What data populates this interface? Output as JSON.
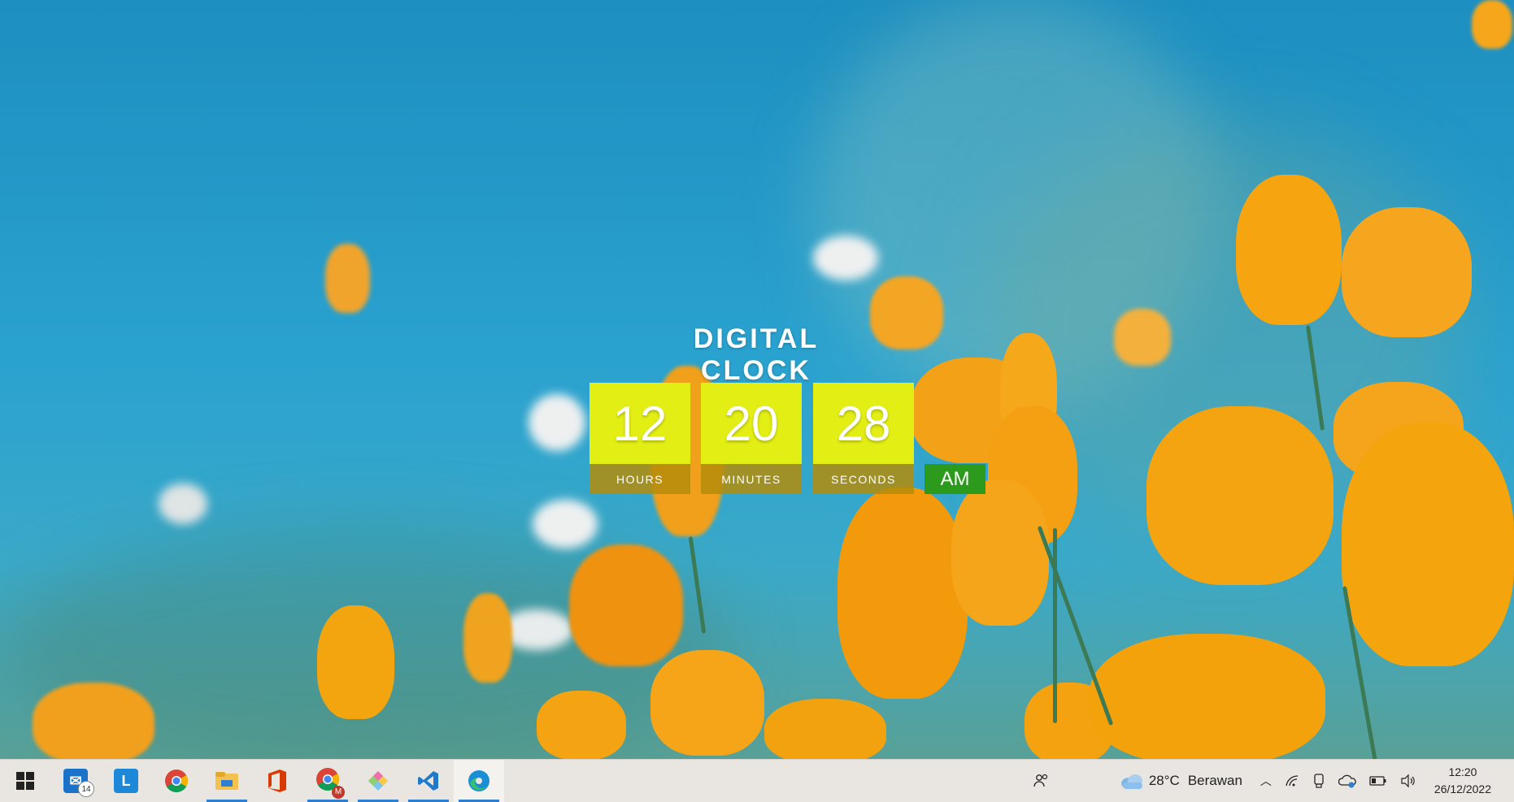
{
  "clock": {
    "title": "DIGITAL CLOCK",
    "hours": "12",
    "hours_label": "HOURS",
    "minutes": "20",
    "minutes_label": "MINUTES",
    "seconds": "28",
    "seconds_label": "SECONDS",
    "period": "AM",
    "colors": {
      "digit_bg": "#e3ef14",
      "label_bg": "#b48c0a",
      "ampm_bg": "#2c9a1c"
    }
  },
  "taskbar": {
    "apps": [
      {
        "icon": "windows-start-icon"
      },
      {
        "icon": "mail-icon",
        "badge": "14"
      },
      {
        "icon": "l-app-icon",
        "letter": "L"
      },
      {
        "icon": "chrome-icon"
      },
      {
        "icon": "file-explorer-icon"
      },
      {
        "icon": "office-icon"
      },
      {
        "icon": "chrome-profile-icon",
        "letter": "M"
      },
      {
        "icon": "paint-icon"
      },
      {
        "icon": "vscode-icon"
      },
      {
        "icon": "edge-icon"
      }
    ],
    "tray": {
      "weather_temp": "28°C",
      "weather_text": "Berawan",
      "time": "12:20",
      "date": "26/12/2022"
    }
  }
}
